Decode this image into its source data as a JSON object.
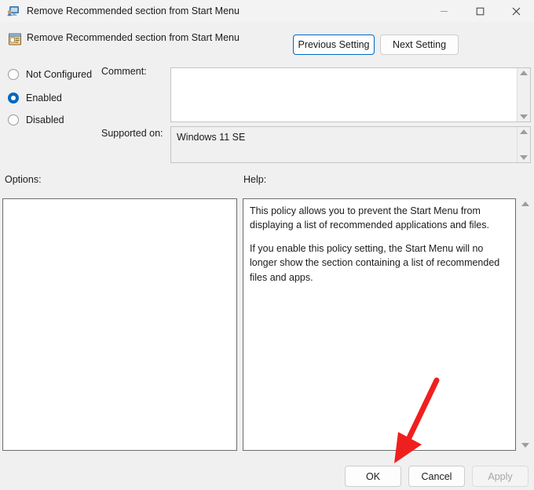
{
  "window": {
    "title": "Remove Recommended section from Start Menu",
    "icon": "policy-computer-icon",
    "controls": {
      "minimize": "—",
      "maximize": "☐",
      "close": "✕"
    }
  },
  "header": {
    "icon": "policy-setting-icon",
    "title": "Remove Recommended section from Start Menu",
    "previous_setting_label": "Previous Setting",
    "next_setting_label": "Next Setting"
  },
  "state_options": [
    {
      "label": "Not Configured",
      "selected": false
    },
    {
      "label": "Enabled",
      "selected": true
    },
    {
      "label": "Disabled",
      "selected": false
    }
  ],
  "comment": {
    "label": "Comment:",
    "value": "",
    "scroll_up_icon": "triangle-up-icon",
    "scroll_down_icon": "triangle-down-icon"
  },
  "supported_on": {
    "label": "Supported on:",
    "value": "Windows 11 SE",
    "scroll_up_icon": "triangle-up-icon",
    "scroll_down_icon": "triangle-down-icon"
  },
  "options": {
    "label": "Options:",
    "content": ""
  },
  "help": {
    "label": "Help:",
    "paragraphs": [
      "This policy allows you to prevent the Start Menu from displaying a list of recommended applications and files.",
      "If you enable this policy setting, the Start Menu will no longer show the section containing a list of recommended files and apps."
    ],
    "scroll_up_icon": "triangle-up-icon",
    "scroll_down_icon": "triangle-down-icon"
  },
  "footer": {
    "ok_label": "OK",
    "cancel_label": "Cancel",
    "apply_label": "Apply",
    "apply_disabled": true
  },
  "annotation": {
    "type": "arrow",
    "color": "#f01f1f",
    "points_to": "OK"
  },
  "colors": {
    "accent": "#0067c0",
    "window_background": "#f0f0f0",
    "titlebar_background": "#f3f3f3",
    "field_background": "#ffffff",
    "readonly_field_background": "#f0f0f0",
    "panel_border": "#6b6b6b",
    "disabled_text": "#a5a5a5",
    "annotation_red": "#f01f1f"
  }
}
